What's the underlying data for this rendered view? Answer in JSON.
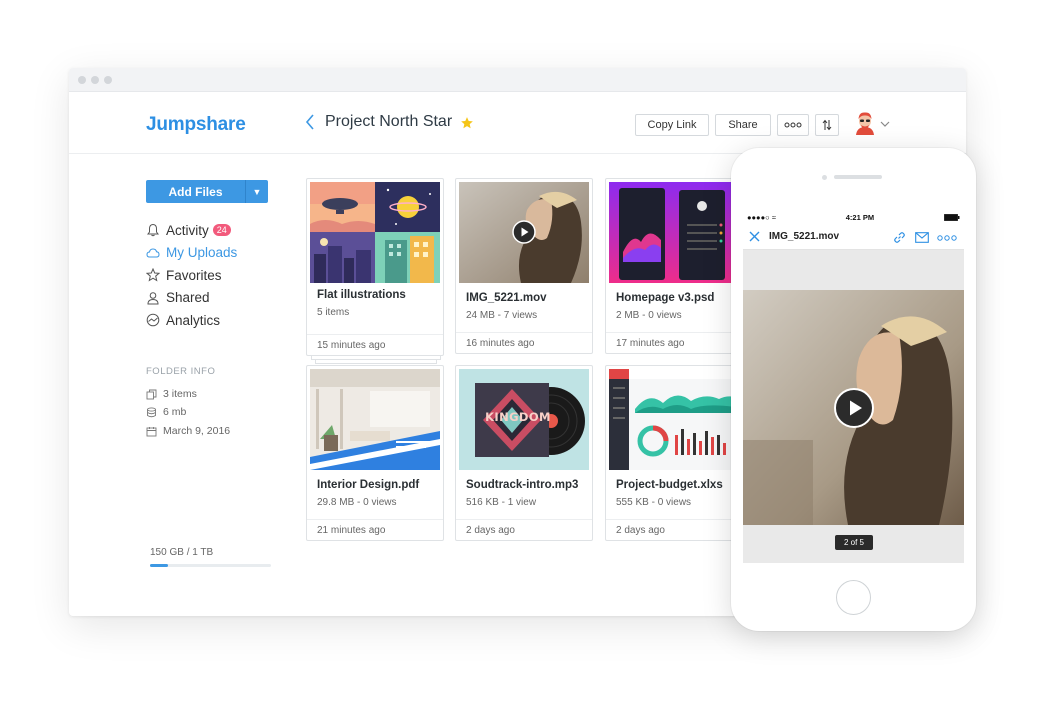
{
  "app": {
    "logo": "Jumpshare"
  },
  "header": {
    "folder_title": "Project North Star",
    "copy_link": "Copy Link",
    "share": "Share"
  },
  "sidebar": {
    "add_files": "Add Files",
    "items": [
      {
        "label": "Activity",
        "badge": "24",
        "icon": "bell-icon"
      },
      {
        "label": "My Uploads",
        "icon": "cloud-icon",
        "active": true
      },
      {
        "label": "Favorites",
        "icon": "star-icon"
      },
      {
        "label": "Shared",
        "icon": "user-icon"
      },
      {
        "label": "Analytics",
        "icon": "chart-icon"
      }
    ],
    "folder_info": {
      "heading": "FOLDER INFO",
      "items_count": "3 items",
      "size": "6 mb",
      "date": "March 9, 2016"
    },
    "storage": {
      "label": "150 GB / 1 TB",
      "used_fraction": 0.15
    }
  },
  "files": [
    {
      "name": "Flat illustrations",
      "meta": "5 items",
      "time": "15 minutes ago"
    },
    {
      "name": "IMG_5221.mov",
      "meta": "24 MB - 7 views",
      "time": "16 minutes ago"
    },
    {
      "name": "Homepage v3.psd",
      "meta": "2 MB - 0 views",
      "time": "17 minutes ago"
    },
    {
      "name": "Interior Design.pdf",
      "meta": "29.8 MB - 0 views",
      "time": "21 minutes ago"
    },
    {
      "name": "Soudtrack-intro.mp3",
      "meta": "516 KB - 1 view",
      "time": "2 days ago"
    },
    {
      "name": "Project-budget.xlxs",
      "meta": "555 KB - 0 views",
      "time": "2 days ago"
    }
  ],
  "thumb_text": {
    "album": "KINGDOM"
  },
  "phone": {
    "time": "4:21 PM",
    "title": "IMG_5221.mov",
    "pager": "2 of 5"
  },
  "colors": {
    "accent": "#3d98e3",
    "badge": "#f25a7c",
    "star": "#f5c518"
  }
}
